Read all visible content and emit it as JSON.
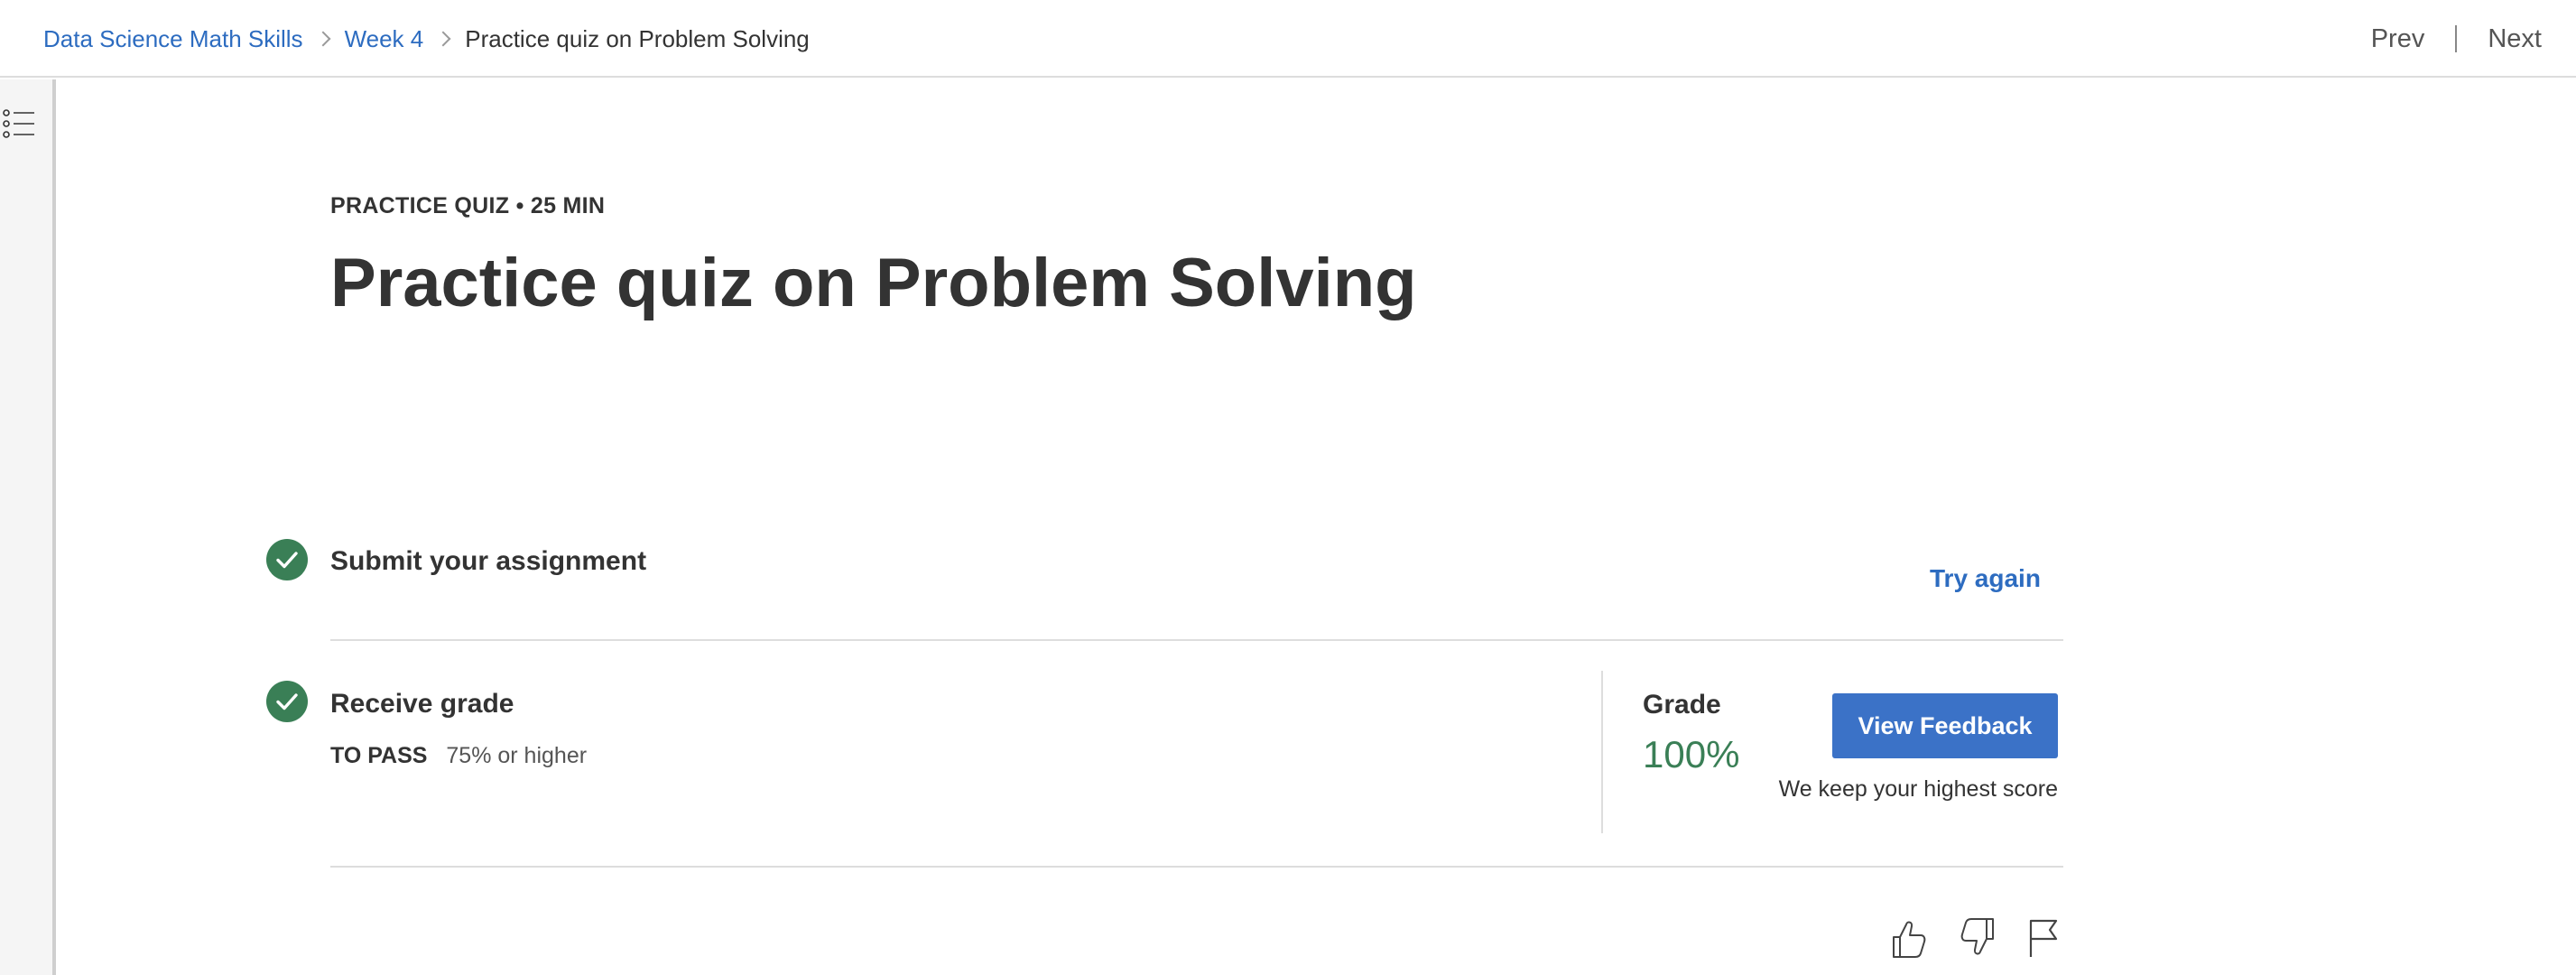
{
  "breadcrumb": {
    "course": "Data Science Math Skills",
    "week": "Week 4",
    "current": "Practice quiz on Problem Solving"
  },
  "pager": {
    "prev": "Prev",
    "next": "Next"
  },
  "header": {
    "kicker": "PRACTICE QUIZ • 25 MIN",
    "title": "Practice quiz on Problem Solving"
  },
  "steps": {
    "submit": {
      "title": "Submit your assignment",
      "action": "Try again"
    },
    "grade": {
      "title": "Receive grade",
      "pass_label": "TO PASS",
      "pass_value": "75% or higher",
      "grade_label": "Grade",
      "grade_value": "100%",
      "button": "View Feedback",
      "note": "We keep your highest score"
    }
  },
  "icons": {
    "toc": "list-icon",
    "check": "check-circle-icon",
    "like": "thumbs-up-icon",
    "dislike": "thumbs-down-icon",
    "report": "flag-icon"
  },
  "colors": {
    "link": "#2d6cc0",
    "success": "#3a7f56",
    "primary_button": "#3b72c7"
  }
}
